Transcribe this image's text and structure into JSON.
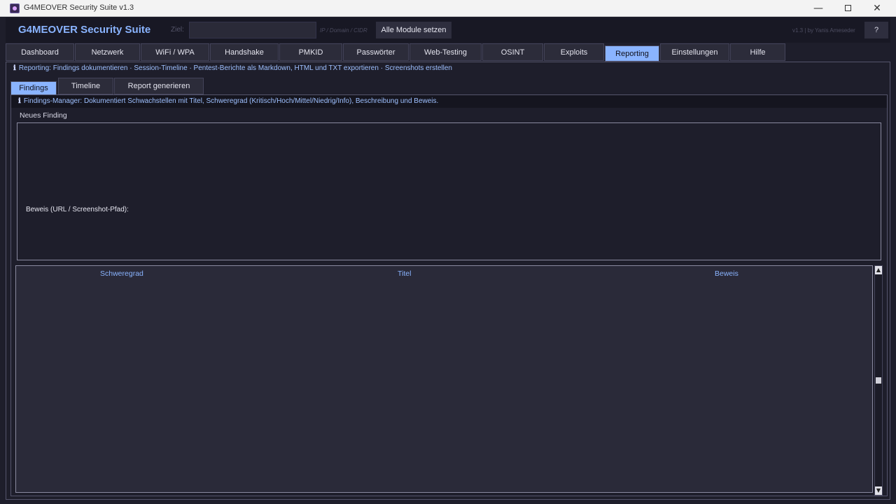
{
  "window": {
    "title": "G4MEOVER Security Suite  v1.3",
    "minimize_glyph": "—",
    "close_glyph": "✕"
  },
  "header": {
    "app_title": "G4MEOVER Security Suite",
    "target_label": "Ziel:",
    "target_value": "",
    "target_hint": "IP / Domain / CIDR",
    "set_all_button": "Alle Module setzen",
    "version_text": "v1.3  |  by Yanis Ameseder",
    "help_button": "?"
  },
  "main_tabs": [
    {
      "label": "Dashboard"
    },
    {
      "label": "Netzwerk"
    },
    {
      "label": "WiFi / WPA"
    },
    {
      "label": "Handshake"
    },
    {
      "label": "PMKID"
    },
    {
      "label": "Passwörter"
    },
    {
      "label": "Web-Testing"
    },
    {
      "label": "OSINT"
    },
    {
      "label": "Exploits"
    },
    {
      "label": "Reporting"
    },
    {
      "label": "Einstellungen"
    },
    {
      "label": "Hilfe"
    }
  ],
  "active_main_tab": "Reporting",
  "reporting": {
    "info_icon": "ℹ",
    "info": "Reporting: Findings dokumentieren · Session-Timeline · Pentest-Berichte als Markdown, HTML und TXT exportieren · Screenshots erstellen",
    "sub_tabs": [
      {
        "label": "Findings"
      },
      {
        "label": "Timeline"
      },
      {
        "label": "Report generieren"
      }
    ],
    "active_sub_tab": "Findings",
    "findings": {
      "info": "Findings-Manager: Dokumentiert Schwachstellen mit Titel, Schweregrad (Kritisch/Hoch/Mittel/Niedrig/Info), Beschreibung und Beweis.",
      "new_finding_group": "Neues Finding",
      "proof_label": "Beweis (URL / Screenshot-Pfad):",
      "table_headers": {
        "severity": "Schweregrad",
        "title": "Titel",
        "proof": "Beweis"
      },
      "rows": []
    }
  },
  "colors": {
    "accent": "#8ab4ff",
    "background": "#1e1e2b",
    "tab_background": "#2c2c3a"
  }
}
